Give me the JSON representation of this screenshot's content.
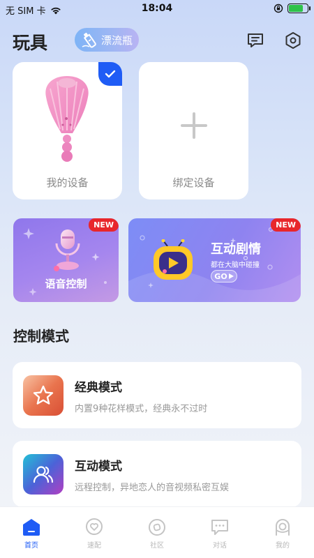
{
  "status": {
    "carrier": "无 SIM 卡",
    "time": "18:04",
    "battery_level": 0.75
  },
  "header": {
    "title": "玩具",
    "drift_bottle_label": "漂流瓶",
    "message_icon": "message-icon",
    "settings_icon": "hexagon-settings-icon"
  },
  "devices": [
    {
      "name": "我的设备",
      "selected": true
    },
    {
      "name": "绑定设备"
    }
  ],
  "banners": {
    "voice": {
      "label": "语音控制",
      "badge": "NEW"
    },
    "story": {
      "title": "互动剧情",
      "subtitle": "都在大脑中碰撞",
      "go": "GO",
      "badge": "NEW"
    }
  },
  "control_section": {
    "title": "控制模式",
    "modes": [
      {
        "name": "经典模式",
        "desc": "内置9种花样模式，经典永不过时",
        "icon": "star-icon"
      },
      {
        "name": "互动模式",
        "desc": "远程控制，异地恋人的音视频私密互娱",
        "icon": "users-icon"
      }
    ]
  },
  "tabs": [
    {
      "label": "首页",
      "icon": "home-icon",
      "active": true
    },
    {
      "label": "速配",
      "icon": "heart-bubble-icon"
    },
    {
      "label": "社区",
      "icon": "community-icon"
    },
    {
      "label": "对话",
      "icon": "chat-icon"
    },
    {
      "label": "我的",
      "icon": "profile-icon"
    }
  ],
  "colors": {
    "accent": "#1f5cf5",
    "badge_red": "#e8262b"
  }
}
